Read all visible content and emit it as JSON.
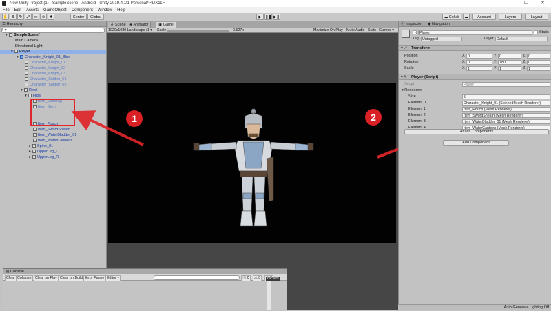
{
  "window": {
    "title": "New Unity Project (1) - SampleScene - Android - Unity 2019.4.1f1 Personal* <DX11>",
    "controls": [
      "–",
      "☐",
      "✕"
    ]
  },
  "menubar": [
    "File",
    "Edit",
    "Assets",
    "GameObject",
    "Component",
    "Window",
    "Help"
  ],
  "toolbar": {
    "center": "Center",
    "global": "Global",
    "collab": "Collab",
    "account": "Account",
    "layers": "Layers",
    "layout": "Layout"
  },
  "hierarchy": {
    "title": "Hierarchy",
    "create": "+ ▾",
    "search_placeholder": "All",
    "items": [
      {
        "label": "SampleScene*",
        "style": "bold"
      },
      {
        "label": "Main Camera",
        "style": "normal"
      },
      {
        "label": "Directional Light",
        "style": "normal"
      },
      {
        "label": "Player",
        "style": "selected"
      },
      {
        "label": "Character_Knight_01_Blue",
        "style": "blue"
      },
      {
        "label": "Character_Knight_01",
        "style": "faint"
      },
      {
        "label": "Character_Knight_02",
        "style": "faint"
      },
      {
        "label": "Character_Knight_03",
        "style": "faint"
      },
      {
        "label": "Character_Soldier_01",
        "style": "faint"
      },
      {
        "label": "Character_Soldier_02",
        "style": "faint"
      },
      {
        "label": "Root",
        "style": "blue"
      },
      {
        "label": "Hips",
        "style": "blue"
      },
      {
        "label": "Item_CoinBag",
        "style": "faint"
      },
      {
        "label": "Item_Gem",
        "style": "faint"
      },
      {
        "label": "Item_Pouch",
        "style": "blue"
      },
      {
        "label": "Item_SwordSheath",
        "style": "blue"
      },
      {
        "label": "Item_WaterBladder_01",
        "style": "blue"
      },
      {
        "label": "Item_WaterCanteen",
        "style": "blue"
      },
      {
        "label": "Spine_01",
        "style": "blue"
      },
      {
        "label": "UpperLeg_L",
        "style": "blue"
      },
      {
        "label": "UpperLeg_R",
        "style": "blue"
      }
    ]
  },
  "scene_tabs": [
    "Scene",
    "Animator",
    "Game"
  ],
  "game_bar": {
    "display": "1920x1080 Landscape (1 ▾",
    "scale_label": "Scale",
    "scale_value": "0.527x",
    "maximize": "Maximize On Play",
    "mute": "Mute Audio",
    "stats": "Stats",
    "gizmos": "Gizmos ▾"
  },
  "console": {
    "title": "Console",
    "buttons": [
      "Clear",
      "Collapse",
      "Clear on Play",
      "Clear on Build",
      "Error Pause",
      "Editor ▾"
    ],
    "counts": [
      "0",
      "0",
      "0"
    ],
    "characters_label": "racters"
  },
  "inspector": {
    "tabs": [
      "Inspector",
      "Navigation"
    ],
    "object_name": "Player",
    "static_label": "Static",
    "tag_label": "Tag",
    "tag_value": "Untagged",
    "layer_label": "Layer",
    "layer_value": "Default",
    "transform": {
      "title": "Transform",
      "rows": [
        {
          "label": "Position",
          "x": "0",
          "y": "0",
          "z": "0"
        },
        {
          "label": "Rotation",
          "x": "0",
          "y": "180",
          "z": "0"
        },
        {
          "label": "Scale",
          "x": "1",
          "y": "1",
          "z": "1"
        }
      ]
    },
    "script": {
      "title": "Player (Script)",
      "script_label": "Script",
      "script_value": "Player",
      "renderers_label": "Renderers",
      "size_label": "Size",
      "size_value": "5",
      "elements": [
        {
          "label": "Element 0",
          "value": "Character_Knight_01 (Skinned Mesh Renderer)"
        },
        {
          "label": "Element 1",
          "value": "Item_Pouch (Mesh Renderer)"
        },
        {
          "label": "Element 2",
          "value": "Item_SwordSheath (Mesh Renderer)"
        },
        {
          "label": "Element 3",
          "value": "Item_WaterBladder_01 (Mesh Renderer)"
        },
        {
          "label": "Element 4",
          "value": "Item_WaterCanteen (Mesh Renderer)"
        }
      ],
      "attach_button": "Attach Components"
    },
    "add_component": "Add Component"
  },
  "annotations": {
    "badge1": "1",
    "badge2": "2"
  },
  "status": {
    "lighting": "Auto Generate Lighting Off"
  },
  "colors": {
    "annotation_red": "#d92024",
    "selection": "#8fb0e8",
    "prefab_blue": "#1b3fa8"
  }
}
